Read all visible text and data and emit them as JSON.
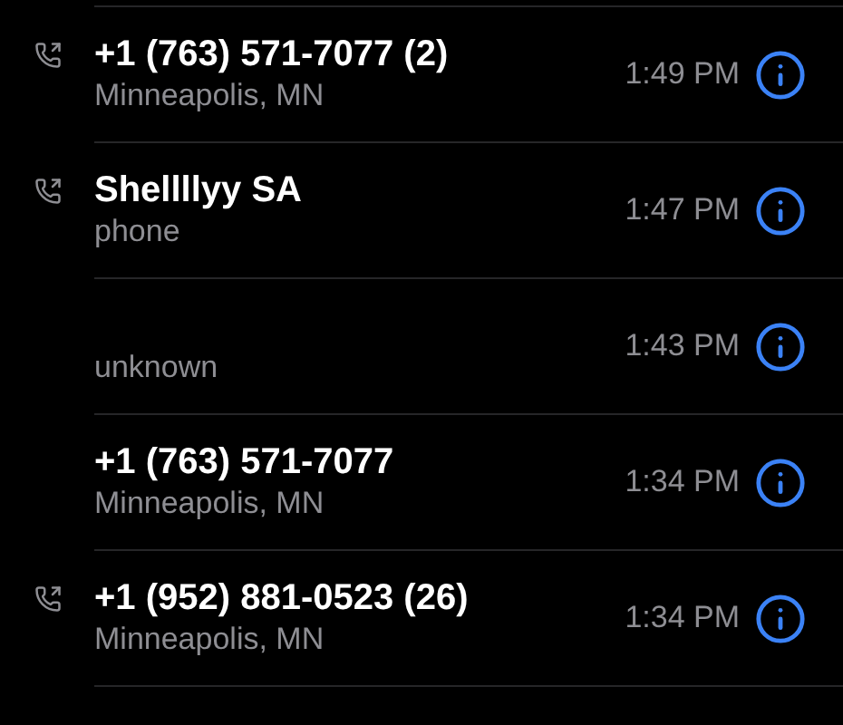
{
  "calls": [
    {
      "name": "+1 (763) 571-7077 (2)",
      "detail": "Minneapolis, MN",
      "time": "1:49 PM",
      "outgoing": true
    },
    {
      "name": "Shellllyy SA",
      "detail": "phone",
      "time": "1:47 PM",
      "outgoing": true
    },
    {
      "detail": "unknown",
      "time": "1:43 PM",
      "outgoing": false
    },
    {
      "name": "+1 (763) 571-7077",
      "detail": "Minneapolis, MN",
      "time": "1:34 PM",
      "outgoing": false
    },
    {
      "name": "+1 (952) 881-0523 (26)",
      "detail": "Minneapolis, MN",
      "time": "1:34 PM",
      "outgoing": true
    }
  ]
}
